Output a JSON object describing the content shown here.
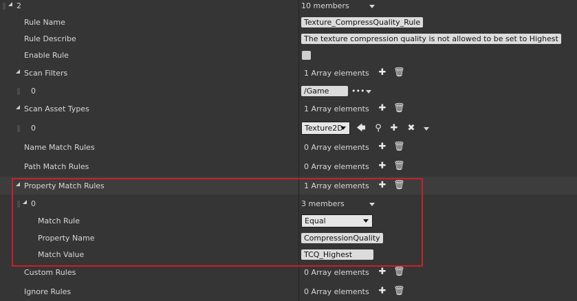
{
  "root": {
    "index": "2",
    "members": "10 members"
  },
  "rows": {
    "rule_name": {
      "label": "Rule Name",
      "value": "Texture_CompressQuality_Rule"
    },
    "rule_describe": {
      "label": "Rule Describe",
      "value": "The texture compression quality is not allowed to be set to Highest"
    },
    "enable_rule": {
      "label": "Enable Rule",
      "checked": false
    },
    "scan_filters": {
      "label": "Scan Filters",
      "count": "1 Array elements"
    },
    "scan_filters_0": {
      "index": "0",
      "value": "/Game"
    },
    "scan_asset_types": {
      "label": "Scan Asset Types",
      "count": "1 Array elements"
    },
    "scan_asset_types_0": {
      "index": "0",
      "value": "Texture2D"
    },
    "name_match_rules": {
      "label": "Name Match Rules",
      "count": "0 Array elements"
    },
    "path_match_rules": {
      "label": "Path Match Rules",
      "count": "0 Array elements"
    },
    "property_match_rules": {
      "label": "Property Match Rules",
      "count": "1 Array elements"
    },
    "property_match_rules_0": {
      "index": "0",
      "members": "3 members"
    },
    "match_rule": {
      "label": "Match Rule",
      "value": "Equal"
    },
    "property_name": {
      "label": "Property Name",
      "value": "CompressionQuality"
    },
    "match_value": {
      "label": "Match Value",
      "value": "TCQ_Highest"
    },
    "custom_rules": {
      "label": "Custom Rules",
      "count": "0 Array elements"
    },
    "ignore_rules": {
      "label": "Ignore Rules",
      "count": "0 Array elements"
    }
  },
  "icons": {
    "add": "plus-icon",
    "delete": "trash-icon",
    "browse": "ellipsis-icon",
    "back": "arrow-left-icon",
    "find": "magnifier-icon",
    "clear": "x-icon"
  },
  "colors": {
    "background": "#353535",
    "highlight_border": "#c8202b"
  }
}
